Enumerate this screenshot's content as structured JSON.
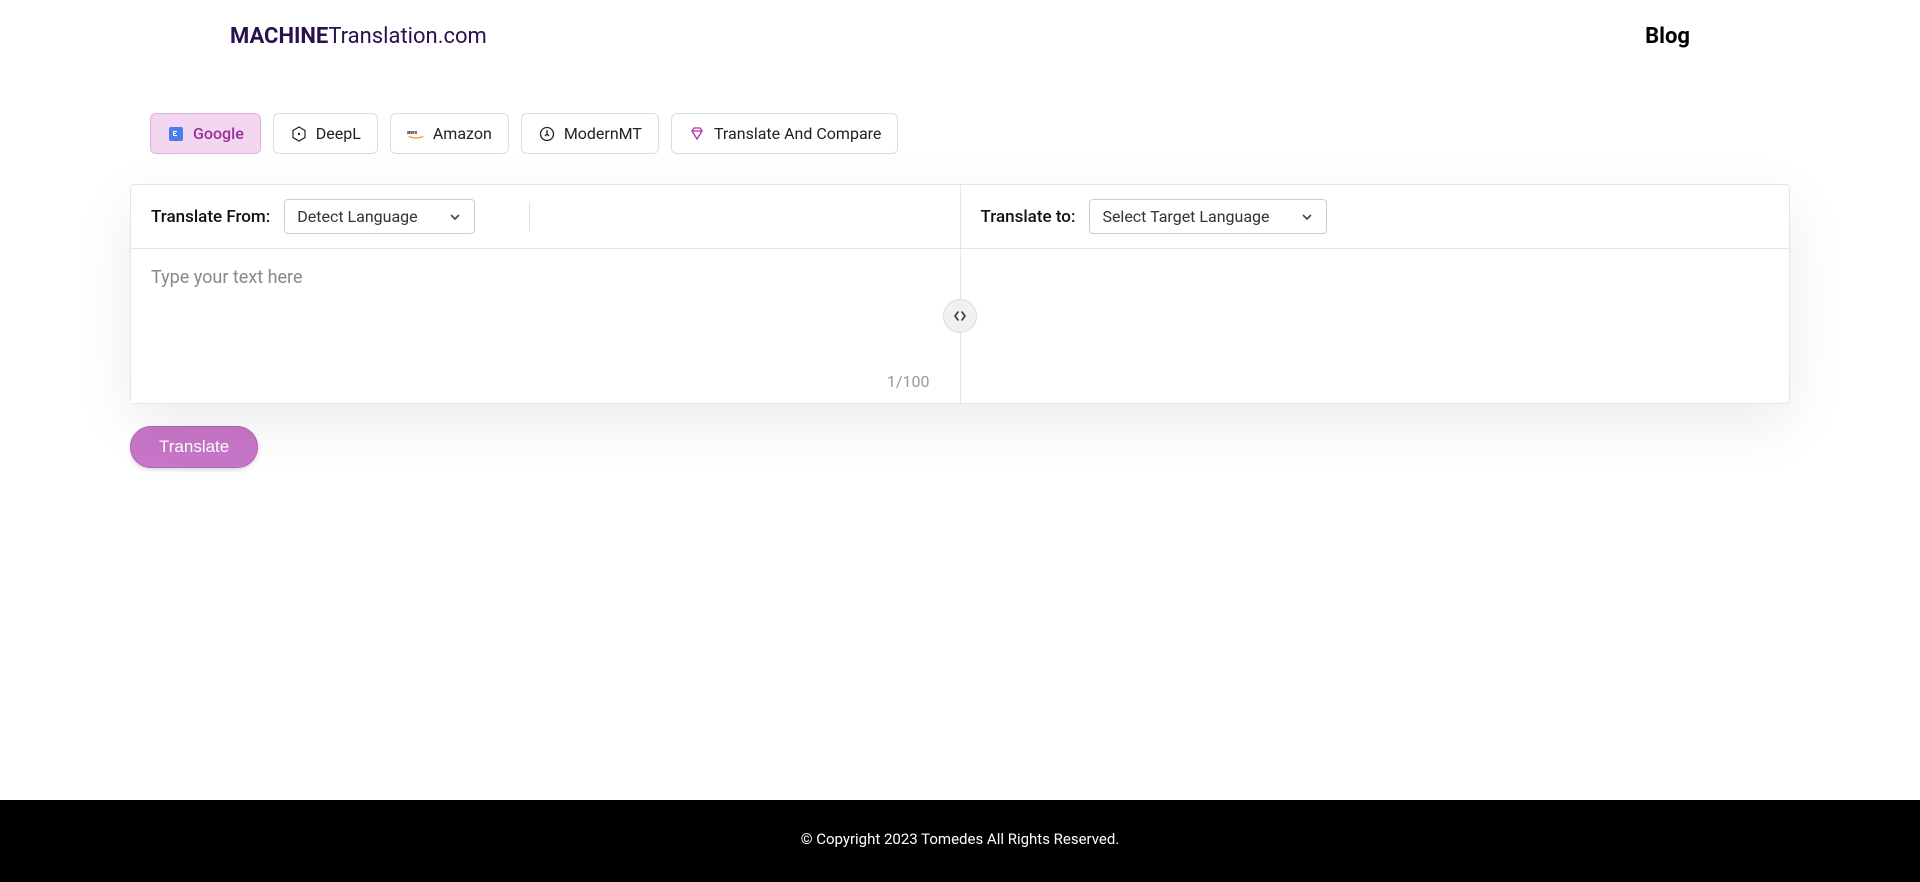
{
  "header": {
    "logo_bold": "MACHINE",
    "logo_rest": "Translation.com",
    "blog_label": "Blog"
  },
  "engines": {
    "google": "Google",
    "deepl": "DeepL",
    "amazon": "Amazon",
    "modernmt": "ModernMT",
    "compare": "Translate And Compare"
  },
  "panes": {
    "from_label": "Translate From:",
    "to_label": "Translate to:",
    "detect_language": "Detect Language",
    "select_target": "Select Target Language",
    "placeholder": "Type your text here",
    "char_count": "1/100"
  },
  "actions": {
    "translate": "Translate"
  },
  "footer": {
    "copyright": "© Copyright 2023 Tomedes All Rights Reserved."
  }
}
